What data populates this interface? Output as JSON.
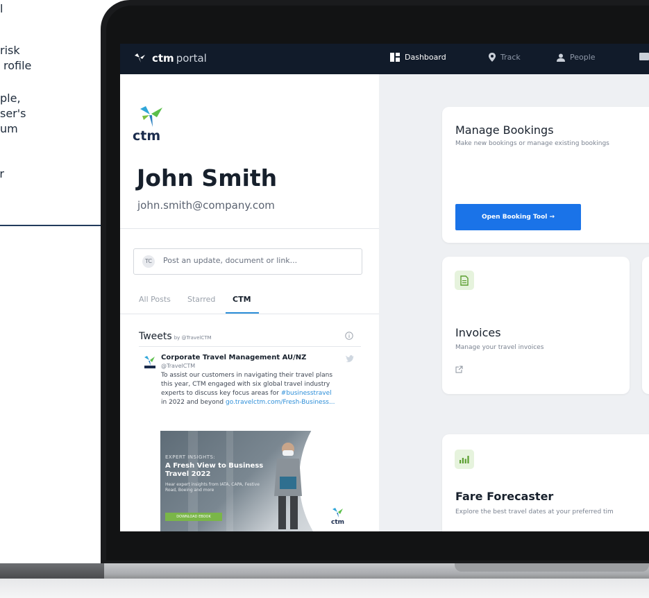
{
  "side_text": {
    "lines": [
      "l",
      "",
      "risk",
      "rofile",
      "",
      "ple,",
      "ser's",
      "um",
      "your"
    ]
  },
  "topbar": {
    "brand": "ctm",
    "portal": "portal",
    "nav": [
      {
        "label": "Dashboard",
        "icon": "dashboard-icon",
        "active": true
      },
      {
        "label": "Track",
        "icon": "location-pin-icon",
        "active": false
      },
      {
        "label": "People",
        "icon": "person-icon",
        "active": false
      }
    ]
  },
  "profile": {
    "logo_text": "ctm",
    "name": "John Smith",
    "email": "john.smith@company.com"
  },
  "post": {
    "avatar_initials": "TC",
    "placeholder": "Post an update, document or link..."
  },
  "feed_tabs": [
    {
      "label": "All Posts",
      "active": false
    },
    {
      "label": "Starred",
      "active": false
    },
    {
      "label": "CTM",
      "active": true
    }
  ],
  "tweets": {
    "heading": "Tweets",
    "by": "by @TravelCTM",
    "tweet": {
      "author": "Corporate Travel Management AU/NZ",
      "handle": "@TravelCTM",
      "body_lines": [
        "To assist our customers in navigating their travel plans",
        "this year, CTM engaged with six global travel industry",
        "experts to discuss key focus areas for "
      ],
      "hashtag": "#businesstravel",
      "body_tail": "in 2022 and beyond ",
      "link": "go.travelctm.com/Fresh-Business...",
      "image": {
        "eyebrow": "EXPERT INSIGHTS:",
        "title": "A Fresh View to Business Travel 2022",
        "sub": "Hear expert insights from IATA, CAPA, Festive Road, Boeing and more",
        "button": "DOWNLOAD EBOOK",
        "logo_text": "ctm"
      }
    }
  },
  "cards": {
    "manage": {
      "title": "Manage Bookings",
      "subtitle": "Make new bookings or manage existing bookings",
      "button": "Open Booking Tool →"
    },
    "invoices": {
      "title": "Invoices",
      "subtitle": "Manage your travel invoices",
      "icon": "document-icon"
    },
    "fare": {
      "title": "Fare Forecaster",
      "subtitle": "Explore the best travel dates at your preferred tim",
      "icon": "bar-chart-icon"
    }
  },
  "colors": {
    "topbar": "#111b2a",
    "primary_button": "#1a73e8",
    "accent_blue": "#2c8ed8",
    "icon_tile": "#e6f3dd",
    "icon_green": "#5a9e2f"
  }
}
